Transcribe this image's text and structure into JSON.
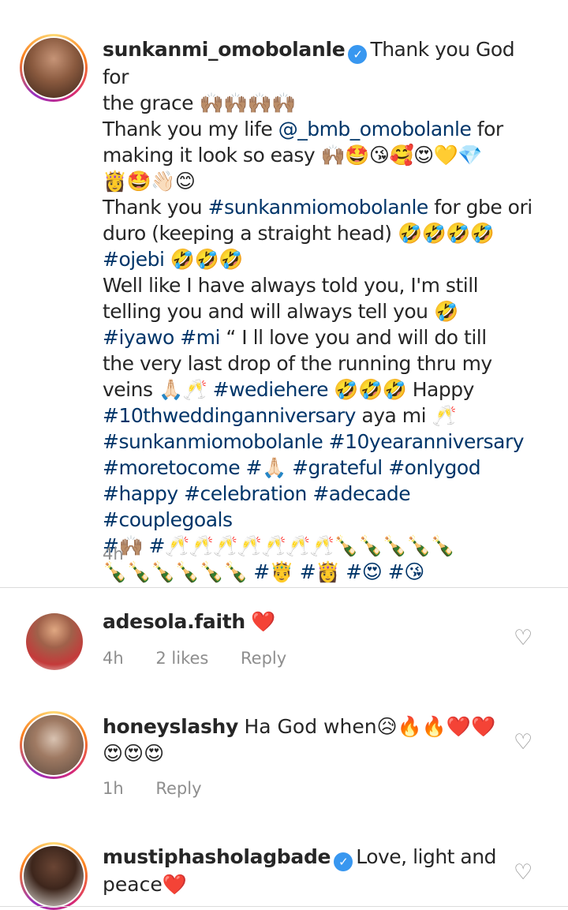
{
  "post": {
    "username": "sunkanmi_omobolanle",
    "caption_lines": [
      "Thank you God for",
      "the grace 🙌🏽🙌🏽🙌🏽🙌🏽",
      "Thank you my life @_bmb_omobolanle for",
      "making it look so easy 🙌🏽🤩😘🥰😍💛💎",
      "👸🤩👋🏻😊",
      "Thank you #sunkanmiomobolanle for gbe ori",
      "duro (keeping a straight head) 🤣🤣🤣🤣",
      "#ojebi 🤣🤣🤣",
      " Well like I have always told you, I'm still",
      "telling you and will always tell you 🤣",
      "#iyawo #mi “ I ll love you and will do till",
      "the very last drop of the   running thru my",
      "veins 🙏🏻🥂 #wediehere 🤣🤣🤣 Happy",
      "#10thweddinganniversary aya mi 🥂",
      "#sunkanmiomobolanle #10yearanniversary",
      "#moretocome #🙏🏻 #grateful #onlygod",
      "#happy #celebration #adecade #couplegoals",
      "#🙌🏽 #🥂🥂🥂🥂🥂🥂🥂🍾🍾🍾🍾🍾",
      "🍾🍾🍾🍾🍾🍾 #🤴 #👸 #😍 #😘"
    ],
    "time": "4h"
  },
  "comments": [
    {
      "username": "adesola.faith",
      "text": "❤️",
      "time": "4h",
      "likes": "2 likes",
      "reply": "Reply",
      "verified": false
    },
    {
      "username": "honeyslashy",
      "text": "Ha God when😥🔥🔥❤️❤️",
      "text_line2": "😍😍😍",
      "time": "1h",
      "reply": "Reply",
      "verified": false
    },
    {
      "username": "mustiphasholagbade",
      "text": "Love, light and",
      "text_line2": "peace❤️",
      "verified": true
    }
  ],
  "icons": {
    "heart": "heart-outline-icon",
    "verified": "verified-badge-icon"
  },
  "colors": {
    "hashtag": "#003569",
    "meta": "#8e8e8e",
    "verified": "#3897f0",
    "divider": "#dbdbdb"
  }
}
